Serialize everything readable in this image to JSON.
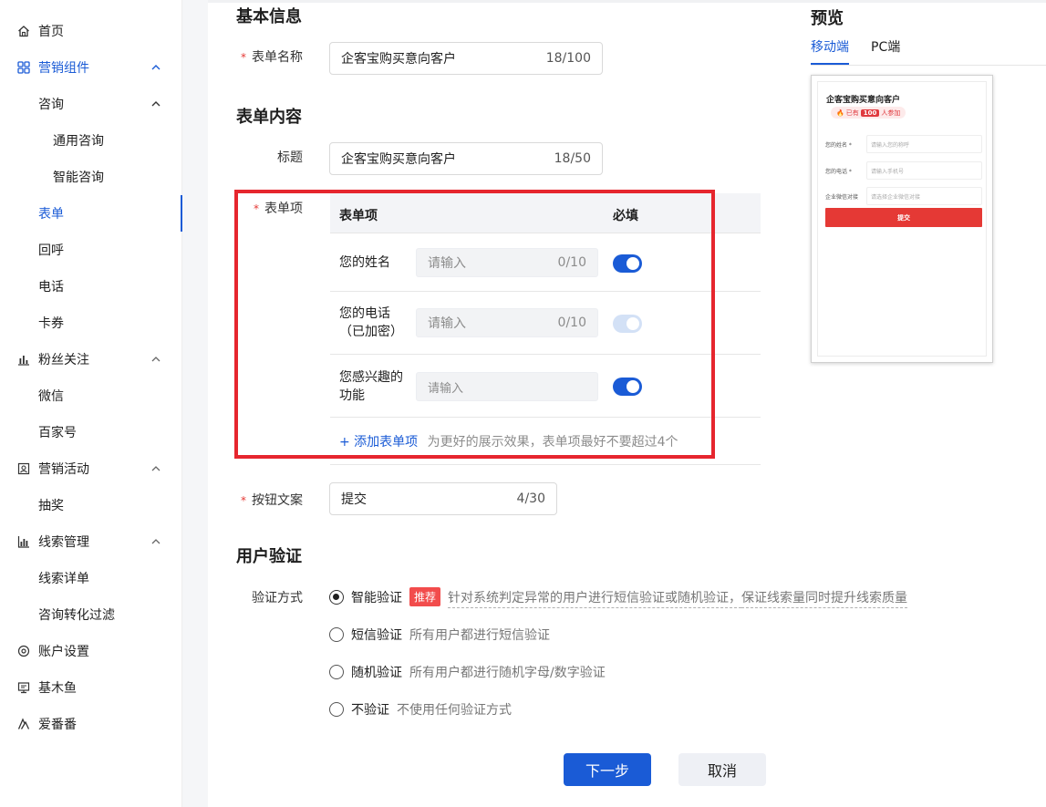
{
  "sidebar": {
    "items": [
      {
        "label": "首页",
        "icon": "home-icon"
      },
      {
        "label": "营销组件",
        "icon": "grid-icon"
      },
      {
        "label": "咨询"
      },
      {
        "label": "通用咨询"
      },
      {
        "label": "智能咨询"
      },
      {
        "label": "表单"
      },
      {
        "label": "回呼"
      },
      {
        "label": "电话"
      },
      {
        "label": "卡券"
      },
      {
        "label": "粉丝关注",
        "icon": "bar-chart-icon"
      },
      {
        "label": "微信"
      },
      {
        "label": "百家号"
      },
      {
        "label": "营销活动",
        "icon": "activity-icon"
      },
      {
        "label": "抽奖"
      },
      {
        "label": "线索管理",
        "icon": "analytics-icon"
      },
      {
        "label": "线索详单"
      },
      {
        "label": "咨询转化过滤"
      },
      {
        "label": "账户设置",
        "icon": "settings-icon"
      },
      {
        "label": "基木鱼",
        "icon": "monitor-icon"
      },
      {
        "label": "爱番番",
        "icon": "triangle-logo-icon"
      }
    ]
  },
  "form": {
    "basic_title": "基本信息",
    "form_name_label": "表单名称",
    "form_name_value": "企客宝购买意向客户",
    "form_name_count": "18/100",
    "content_title": "表单内容",
    "heading_label": "标题",
    "heading_value": "企客宝购买意向客户",
    "heading_count": "18/50",
    "items_label": "表单项",
    "table": {
      "col_item": "表单项",
      "col_required": "必填",
      "rows": [
        {
          "name": "您的姓名",
          "placeholder": "请输入",
          "count": "0/10",
          "required": true
        },
        {
          "name": "您的电话（已加密）",
          "placeholder": "请输入",
          "count": "0/10",
          "required": true
        },
        {
          "name": "您感兴趣的功能",
          "placeholder": "请输入",
          "count": "",
          "required": true
        }
      ],
      "add_link": "+ 添加表单项",
      "add_hint": "为更好的展示效果，表单项最好不要超过4个"
    },
    "button_text_label": "按钮文案",
    "button_text_value": "提交",
    "button_text_count": "4/30"
  },
  "verify": {
    "title": "用户验证",
    "method_label": "验证方式",
    "options": [
      {
        "label": "智能验证",
        "tag": "推荐",
        "desc_a": "针对系统判定异常的用户进行短信验证或随机验证，",
        "desc_b": "保证线索量同时提升线索质量",
        "selected": true
      },
      {
        "label": "短信验证",
        "desc": "所有用户都进行短信验证",
        "selected": false
      },
      {
        "label": "随机验证",
        "desc": "所有用户都进行随机字母/数字验证",
        "selected": false
      },
      {
        "label": "不验证",
        "desc": "不使用任何验证方式",
        "selected": false
      }
    ]
  },
  "actions": {
    "next": "下一步",
    "cancel": "取消"
  },
  "preview": {
    "title": "预览",
    "tabs": [
      "移动端",
      "PC端"
    ],
    "card_title": "企客宝购买意向客户",
    "badge_prefix": "已有",
    "badge_num": "100",
    "badge_suffix": "人参加",
    "fields": [
      {
        "label": "您的姓名 *",
        "placeholder": "请输入您的称呼"
      },
      {
        "label": "您的电话 *",
        "placeholder": "请输入手机号"
      },
      {
        "label": "企业微信对接",
        "placeholder": "请选择企业微信对接"
      }
    ],
    "submit": "提交"
  },
  "colors": {
    "primary": "#1a5bd6",
    "highlight_box": "#e6262e",
    "tag": "#f24c4c"
  }
}
